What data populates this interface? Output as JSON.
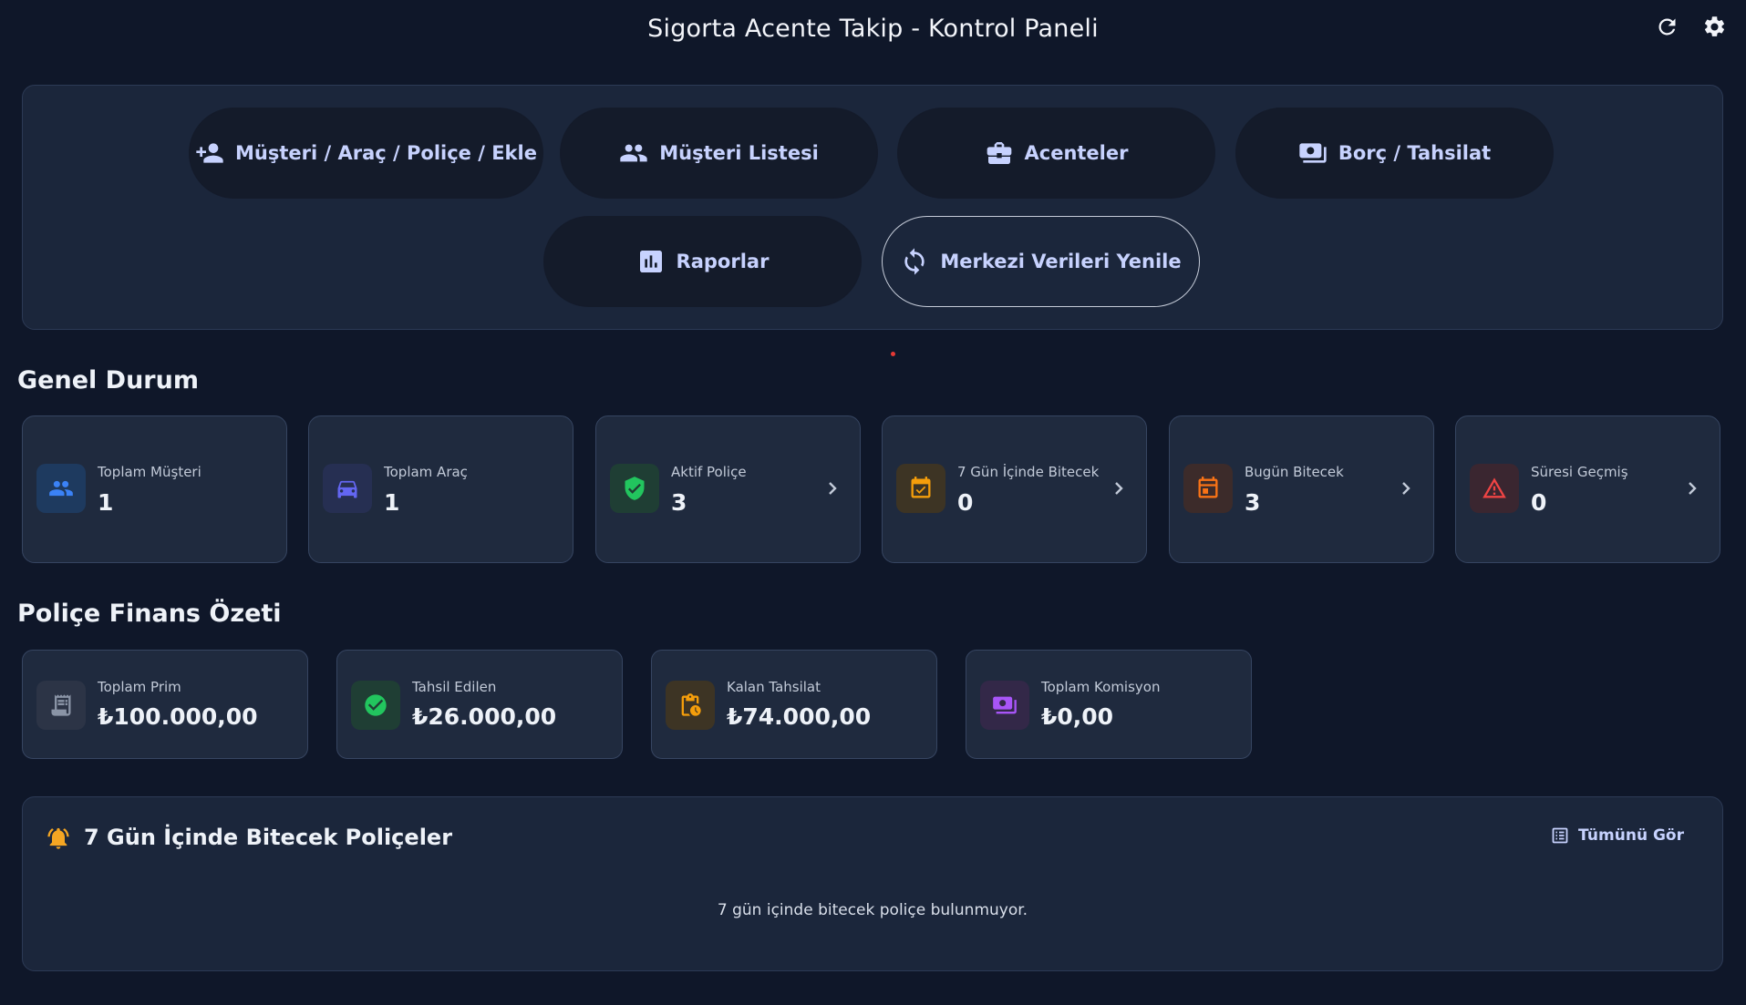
{
  "header": {
    "title": "Sigorta Acente Takip - Kontrol Paneli",
    "icons": [
      "refresh-icon",
      "gear-icon"
    ]
  },
  "actions": {
    "add": {
      "label": "Müşteri / Araç / Poliçe / Ekle",
      "icon": "user-plus-icon"
    },
    "customers": {
      "label": "Müşteri Listesi",
      "icon": "users-icon"
    },
    "agencies": {
      "label": "Acenteler",
      "icon": "briefcase-icon"
    },
    "debt": {
      "label": "Borç / Tahsilat",
      "icon": "money-icon"
    },
    "reports": {
      "label": "Raporlar",
      "icon": "chart-icon"
    },
    "sync": {
      "label": "Merkezi Verileri Yenile",
      "icon": "sync-icon"
    }
  },
  "general": {
    "title": "Genel Durum",
    "cards": [
      {
        "label": "Toplam Müşteri",
        "value": "1",
        "icon": "users-icon",
        "color": "#3b82f6"
      },
      {
        "label": "Toplam Araç",
        "value": "1",
        "icon": "car-icon",
        "color": "#6366f1"
      },
      {
        "label": "Aktif Poliçe",
        "value": "3",
        "icon": "shield-check-icon",
        "color": "#22c55e"
      },
      {
        "label": "7 Gün İçinde Bitecek",
        "value": "0",
        "icon": "calendar-check-icon",
        "color": "#f59e0b"
      },
      {
        "label": "Bugün Bitecek",
        "value": "3",
        "icon": "calendar-today-icon",
        "color": "#f97316"
      },
      {
        "label": "Süresi Geçmiş",
        "value": "0",
        "icon": "warning-icon",
        "color": "#ef4444"
      }
    ]
  },
  "finance": {
    "title": "Poliçe Finans Özeti",
    "cards": [
      {
        "label": "Toplam Prim",
        "value": "₺100.000,00",
        "icon": "receipt-icon",
        "color": "#8a94a6"
      },
      {
        "label": "Tahsil Edilen",
        "value": "₺26.000,00",
        "icon": "check-circle-icon",
        "color": "#22c55e"
      },
      {
        "label": "Kalan Tahsilat",
        "value": "₺74.000,00",
        "icon": "clipboard-clock-icon",
        "color": "#f59e0b"
      },
      {
        "label": "Toplam Komisyon",
        "value": "₺0,00",
        "icon": "money-icon",
        "color": "#a855f7"
      }
    ]
  },
  "expiring": {
    "title": "7 Gün İçinde Bitecek Poliçeler",
    "see_all": "Tümünü Gör",
    "empty": "7 gün içinde bitecek poliçe bulunmuyor."
  }
}
